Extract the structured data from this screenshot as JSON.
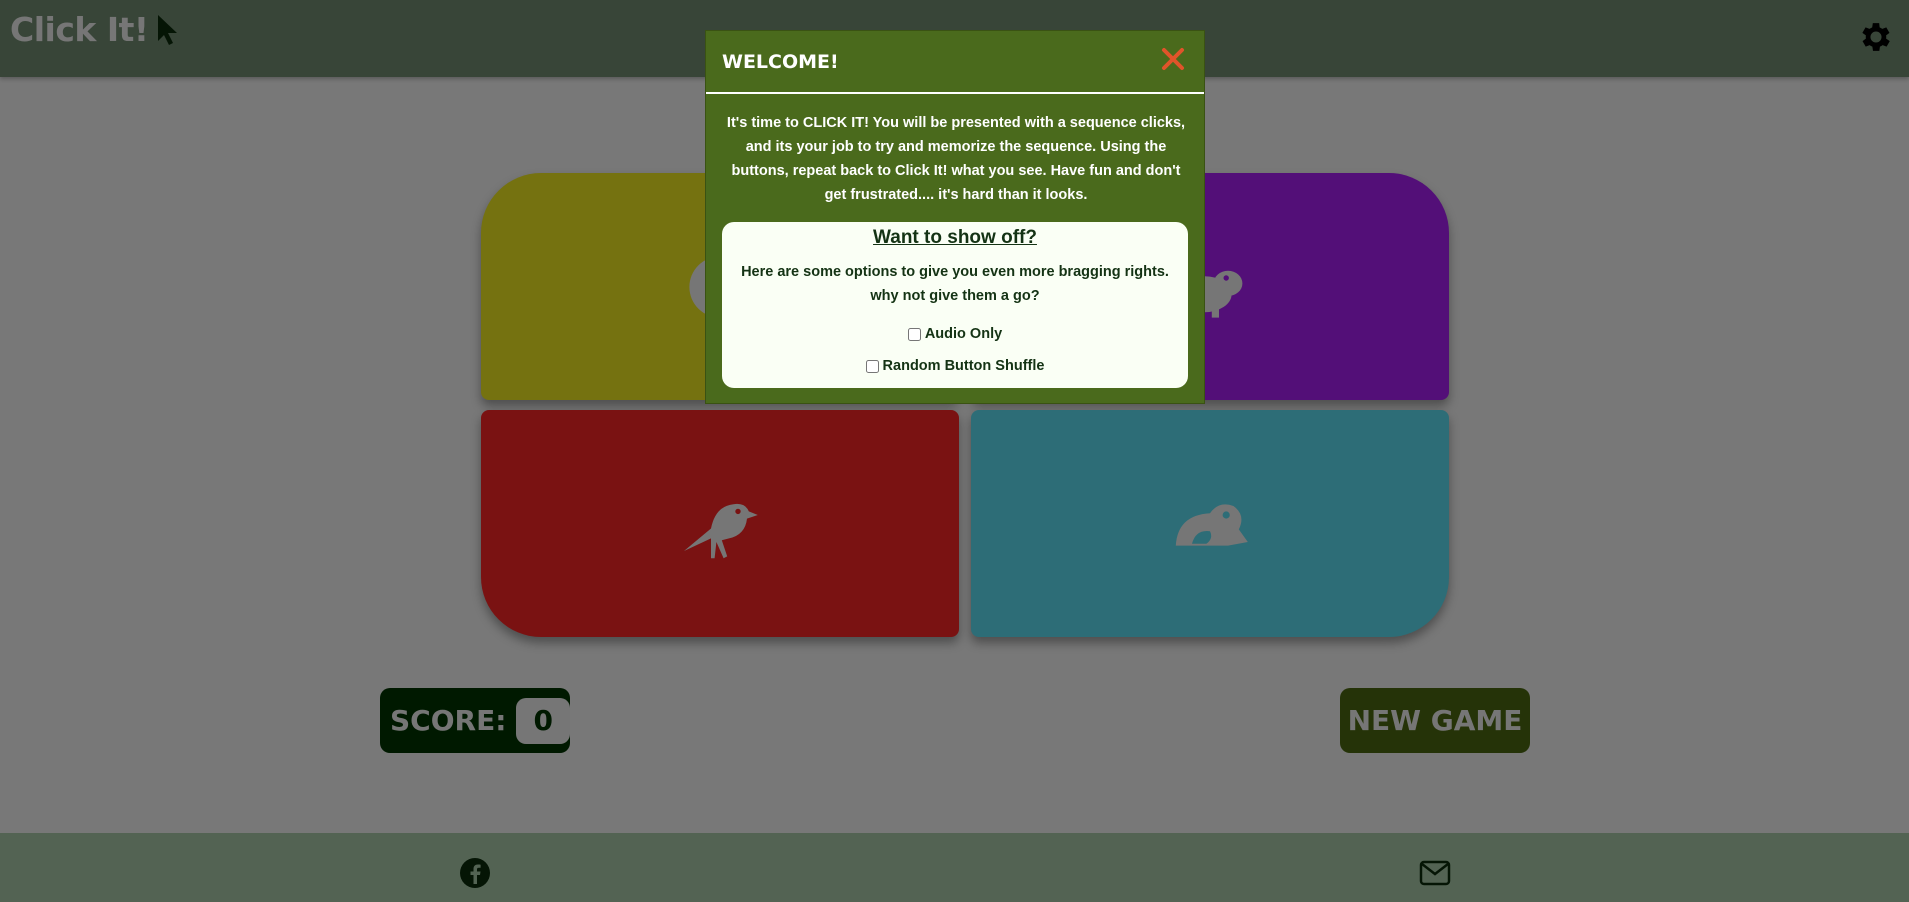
{
  "header": {
    "logo_text": "Click It!",
    "settings_icon": "gear-icon"
  },
  "pads": [
    {
      "color": "yellow",
      "hex": "#ebe421",
      "icon": "monkey-icon"
    },
    {
      "color": "purple",
      "hex": "#a71ff0",
      "icon": "hippo-icon"
    },
    {
      "color": "red",
      "hex": "#f52424",
      "icon": "crow-icon"
    },
    {
      "color": "teal",
      "hex": "#5bdaee",
      "icon": "frog-icon"
    }
  ],
  "score": {
    "label": "SCORE:",
    "value": "0"
  },
  "new_game_label": "NEW GAME",
  "footer": {
    "facebook_icon": "facebook-icon",
    "mail_icon": "envelope-icon"
  },
  "modal": {
    "title": "WELCOME!",
    "intro": "It's time to CLICK IT! You will be presented with a sequence clicks, and its your job to try and memorize the sequence. Using the buttons, repeat back to Click It! what you see. Have fun and don't get frustrated.... it's hard than it looks.",
    "panel": {
      "title": "Want to show off?",
      "text": "Here are some options to give you even more bragging rights. why not give them a go?",
      "options": [
        {
          "label": "Audio Only",
          "checked": false
        },
        {
          "label": "Random Button Shuffle",
          "checked": false
        }
      ]
    }
  },
  "colors": {
    "header_bg": "#708a70",
    "modal_bg": "#4a6a1c",
    "close_icon": "#e0542a",
    "score_bg": "#003300",
    "new_game_bg": "#4a6611"
  }
}
